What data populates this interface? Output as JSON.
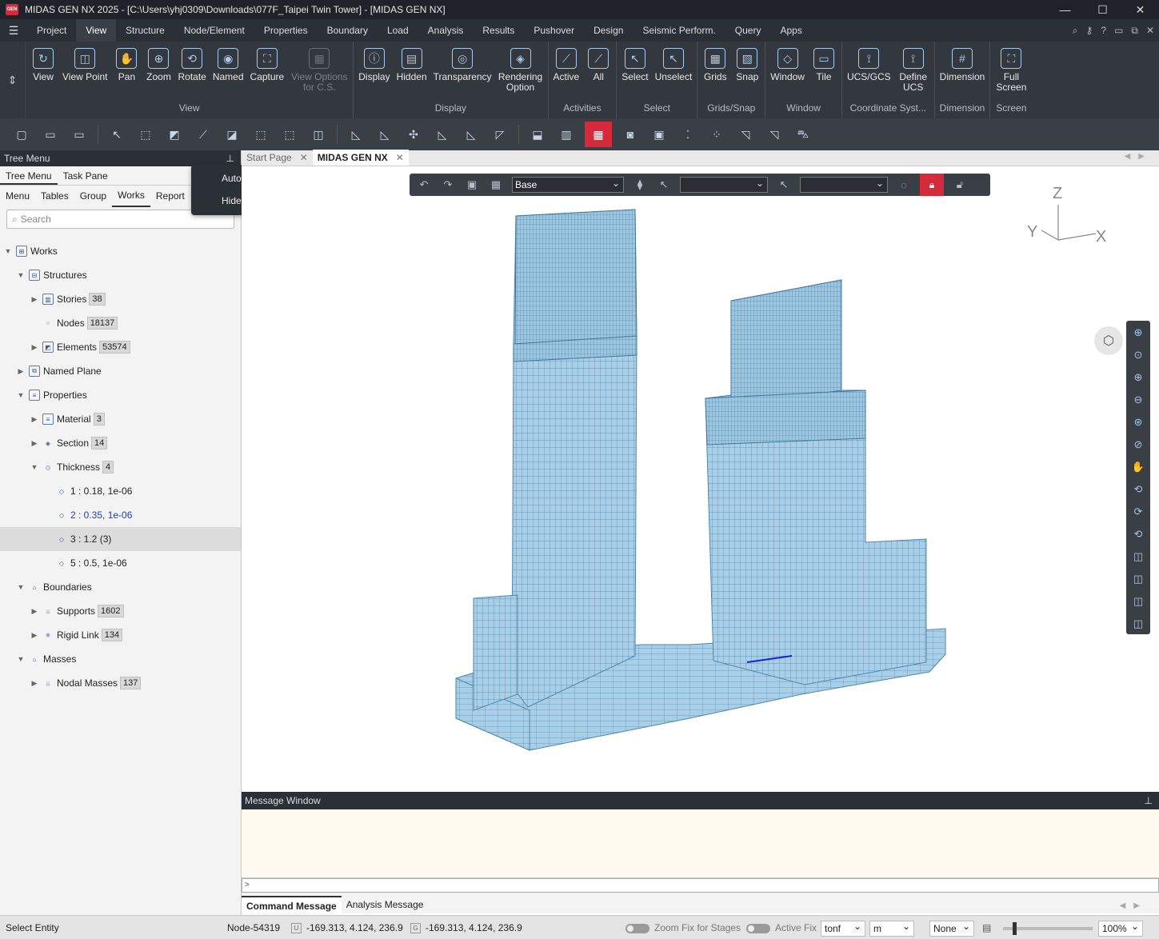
{
  "app": {
    "logo": "GEN",
    "title": "MIDAS GEN NX 2025 - [C:\\Users\\yhj0309\\Downloads\\077F_Taipei Twin Tower] - [MIDAS GEN NX]"
  },
  "menu": {
    "tabs": [
      "Project",
      "View",
      "Structure",
      "Node/Element",
      "Properties",
      "Boundary",
      "Load",
      "Analysis",
      "Results",
      "Pushover",
      "Design",
      "Seismic Perform.",
      "Query",
      "Apps"
    ],
    "active": "View"
  },
  "ribbon": {
    "groups": [
      {
        "label": "View",
        "buttons": [
          {
            "label": "View",
            "icon": "view-icon"
          },
          {
            "label": "View Point",
            "icon": "viewpoint-icon"
          },
          {
            "label": "Pan",
            "icon": "pan-icon"
          },
          {
            "label": "Zoom",
            "icon": "zoom-icon"
          },
          {
            "label": "Rotate",
            "icon": "rotate-icon"
          },
          {
            "label": "Named",
            "icon": "named-icon"
          },
          {
            "label": "Capture",
            "icon": "capture-icon"
          },
          {
            "label": "View Options for C.S.",
            "icon": "view-options-icon",
            "disabled": true
          }
        ]
      },
      {
        "label": "Display",
        "buttons": [
          {
            "label": "Display",
            "icon": "display-icon"
          },
          {
            "label": "Hidden",
            "icon": "hidden-icon"
          },
          {
            "label": "Transparency",
            "icon": "transparency-icon"
          },
          {
            "label": "Rendering Option",
            "icon": "rendering-icon"
          }
        ]
      },
      {
        "label": "Activities",
        "buttons": [
          {
            "label": "Active",
            "icon": "active-icon"
          },
          {
            "label": "All",
            "icon": "all-icon"
          }
        ]
      },
      {
        "label": "Select",
        "buttons": [
          {
            "label": "Select",
            "icon": "select-icon"
          },
          {
            "label": "Unselect",
            "icon": "unselect-icon"
          }
        ]
      },
      {
        "label": "Grids/Snap",
        "buttons": [
          {
            "label": "Grids",
            "icon": "grids-icon"
          },
          {
            "label": "Snap",
            "icon": "snap-icon"
          }
        ]
      },
      {
        "label": "Window",
        "buttons": [
          {
            "label": "Window",
            "icon": "window-icon"
          },
          {
            "label": "Tile",
            "icon": "tile-icon"
          }
        ]
      },
      {
        "label": "Coordinate Syst...",
        "buttons": [
          {
            "label": "UCS/GCS",
            "icon": "ucs-icon"
          },
          {
            "label": "Define UCS",
            "icon": "define-ucs-icon"
          }
        ]
      },
      {
        "label": "Dimension",
        "buttons": [
          {
            "label": "Dimension",
            "icon": "dimension-icon"
          }
        ]
      },
      {
        "label": "Screen",
        "buttons": [
          {
            "label": "Full Screen",
            "icon": "fullscreen-icon"
          }
        ]
      }
    ]
  },
  "tree": {
    "header": "Tree Menu",
    "tabs": [
      "Tree Menu",
      "Task Pane"
    ],
    "subtabs": [
      "Menu",
      "Tables",
      "Group",
      "Works",
      "Report"
    ],
    "search_placeholder": "Search",
    "rows": [
      {
        "label": "Works",
        "badge": ""
      },
      {
        "label": "Structures",
        "badge": ""
      },
      {
        "label": "Stories",
        "badge": "38"
      },
      {
        "label": "Nodes",
        "badge": "18137"
      },
      {
        "label": "Elements",
        "badge": "53574"
      },
      {
        "label": "Named Plane",
        "badge": ""
      },
      {
        "label": "Properties",
        "badge": ""
      },
      {
        "label": "Material",
        "badge": "3"
      },
      {
        "label": "Section",
        "badge": "14"
      },
      {
        "label": "Thickness",
        "badge": "4"
      },
      {
        "label": "1 : 0.18, 1e-06",
        "badge": ""
      },
      {
        "label": "2 : 0.35, 1e-06",
        "badge": ""
      },
      {
        "label": "3 : 1.2 (3)",
        "badge": ""
      },
      {
        "label": "5 : 0.5, 1e-06",
        "badge": ""
      },
      {
        "label": "Boundaries",
        "badge": ""
      },
      {
        "label": "Supports",
        "badge": "1602"
      },
      {
        "label": "Rigid Link",
        "badge": "134"
      },
      {
        "label": "Masses",
        "badge": ""
      },
      {
        "label": "Nodal Masses",
        "badge": "137"
      }
    ]
  },
  "popup": {
    "items": [
      "Auto Hide",
      "Hide"
    ]
  },
  "doctabs": [
    "Start Page",
    "MIDAS GEN NX"
  ],
  "viewport": {
    "stage_select": "Base",
    "axes": {
      "z": "Z",
      "y": "Y",
      "x": "X"
    }
  },
  "message": {
    "title": "Message Window",
    "prompt": ">",
    "tabs": [
      "Command Message",
      "Analysis Message"
    ]
  },
  "status": {
    "mode": "Select Entity",
    "node": "Node-54319",
    "ucs_label": "U",
    "ucs_coords": "-169.313, 4.124, 236.9",
    "gcs_label": "G",
    "gcs_coords": "-169.313, 4.124, 236.9",
    "zoom_fix": "Zoom Fix for Stages",
    "active_fix": "Active Fix",
    "force_unit": "tonf",
    "length_unit": "m",
    "none_select": "None",
    "zoom_level": "100%"
  },
  "colors": {
    "accent": "#d6293b",
    "model_fill": "#a9cfe8",
    "model_line": "#4f86a8"
  }
}
